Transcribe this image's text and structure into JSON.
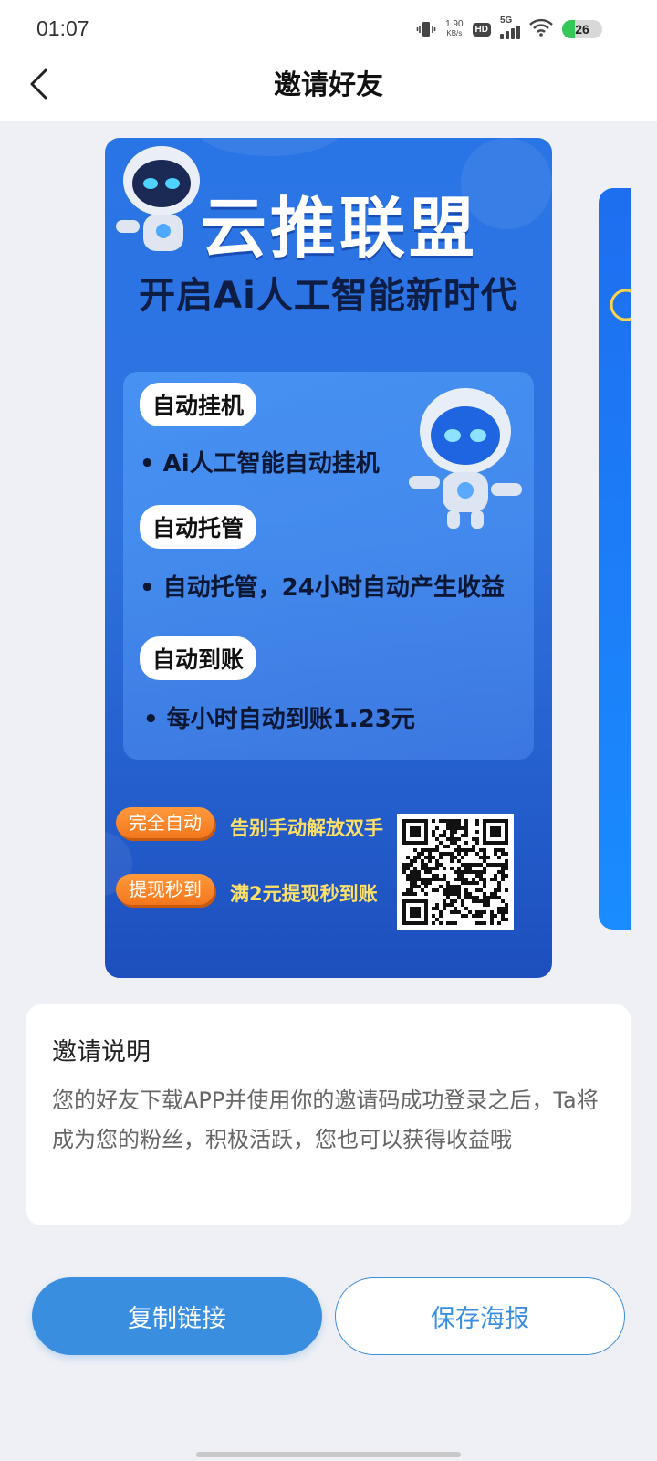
{
  "status_bar": {
    "time": "01:07",
    "net_speed_value": "1.90",
    "net_speed_unit": "KB/s",
    "hd_label": "HD",
    "network_label": "5G",
    "battery_level": "26"
  },
  "nav": {
    "title": "邀请好友"
  },
  "poster": {
    "title": "云推联盟",
    "subtitle": "开启Ai人工智能新时代",
    "features": [
      {
        "tag": "自动挂机",
        "text": "• Ai人工智能自动挂机"
      },
      {
        "tag": "自动托管",
        "text": "• 自动托管，24小时自动产生收益"
      },
      {
        "tag": "自动到账",
        "text": "• 每小时自动到账1.23元"
      }
    ],
    "promos": [
      {
        "pill": "完全自动",
        "text": "告别手动解放双手"
      },
      {
        "pill": "提现秒到",
        "text": "满2元提现秒到账"
      }
    ]
  },
  "info": {
    "title": "邀请说明",
    "text": "您的好友下载APP并使用你的邀请码成功登录之后，Ta将成为您的粉丝，积极活跃，您也可以获得收益哦"
  },
  "buttons": {
    "copy_link": "复制链接",
    "save_poster": "保存海报"
  },
  "colors": {
    "accent": "#3a8ee0",
    "page_bg": "#eef0f5",
    "poster_blue": "#2a75e6",
    "promo_orange": "#f4761c",
    "promo_text": "#ffe066"
  },
  "icons": {
    "back": "chevron-left-icon",
    "vibrate": "vibrate-icon",
    "wifi": "wifi-icon",
    "signal": "signal-icon",
    "battery": "battery-icon",
    "qr": "qr-code-icon",
    "robot": "robot-icon"
  }
}
